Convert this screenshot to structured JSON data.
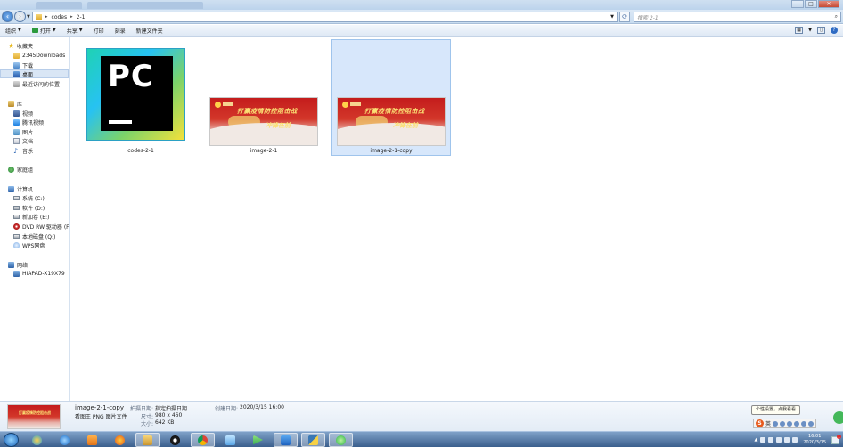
{
  "address": {
    "crumbs": [
      "codes",
      "2-1"
    ],
    "search_placeholder": "搜索 2-1"
  },
  "toolbar": {
    "organize": "组织",
    "open": "打开",
    "share": "共享",
    "print": "打印",
    "burn": "刻录",
    "new_folder": "新建文件夹"
  },
  "sidebar": {
    "favorites": "收藏夹",
    "fav_items": [
      "2345Downloads",
      "下载",
      "桌面",
      "最近访问的位置"
    ],
    "libraries": "库",
    "lib_items": [
      "视频",
      "腾讯视频",
      "图片",
      "文档",
      "音乐"
    ],
    "homegroup": "家庭组",
    "computer": "计算机",
    "computer_items": [
      "系统 (C:)",
      "软件 (D:)",
      "新加卷 (E:)",
      "DVD RW 驱动器 (F:",
      "本地磁盘 (Q:)",
      "WPS网盘"
    ],
    "network": "网络",
    "network_items": [
      "HIAPAD-X19X79"
    ]
  },
  "files": [
    {
      "name": "codes-2-1",
      "icon": "pycharm-icon",
      "selected": false
    },
    {
      "name": "image-2-1",
      "icon": "image-thumbnail",
      "selected": false
    },
    {
      "name": "image-2-1-copy",
      "icon": "image-thumbnail",
      "selected": true
    }
  ],
  "file_icon": {
    "pc_text": "PC"
  },
  "banner": {
    "line1": "打赢疫情防控阻击战",
    "line2": "冲锋在前"
  },
  "details": {
    "filename": "image-2-1-copy",
    "filetype": "看图王 PNG 图片文件",
    "taken_label": "拍摄日期:",
    "taken_value": "指定拍摄日期",
    "dims_label": "尺寸:",
    "dims_value": "980 x 460",
    "size_label": "大小:",
    "size_value": "642 KB",
    "created_label": "创建日期:",
    "created_value": "2020/3/15 16:00"
  },
  "tooltip": "个性设置，点我看看",
  "ime": {
    "lang": "英"
  },
  "tray": {
    "time": "16:01",
    "date": "2020/3/15",
    "notifications": "1"
  },
  "colors": {
    "selection_bg": "#d7e7fb",
    "selection_border": "#9fc4ec",
    "taskbar": "#3b5f8d",
    "banner_red": "#c41c1c"
  }
}
